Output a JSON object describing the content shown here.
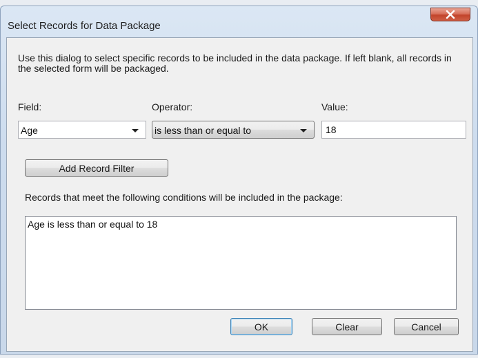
{
  "dialog": {
    "title": "Select Records for Data Package",
    "close_icon": "close-x-icon",
    "description": "Use this dialog to select specific records to be included in the data package. If left blank, all records in the selected form will be packaged.",
    "field_label": "Field:",
    "operator_label": "Operator:",
    "value_label": "Value:",
    "field_value": "Age",
    "operator_value": "is less than or equal to",
    "value_value": "18",
    "add_filter_label": "Add Record Filter",
    "conditions_label": "Records that meet the following conditions will be included in the package:",
    "conditions": [
      "Age is less than or equal to 18"
    ],
    "ok_label": "OK",
    "clear_label": "Clear",
    "cancel_label": "Cancel"
  }
}
